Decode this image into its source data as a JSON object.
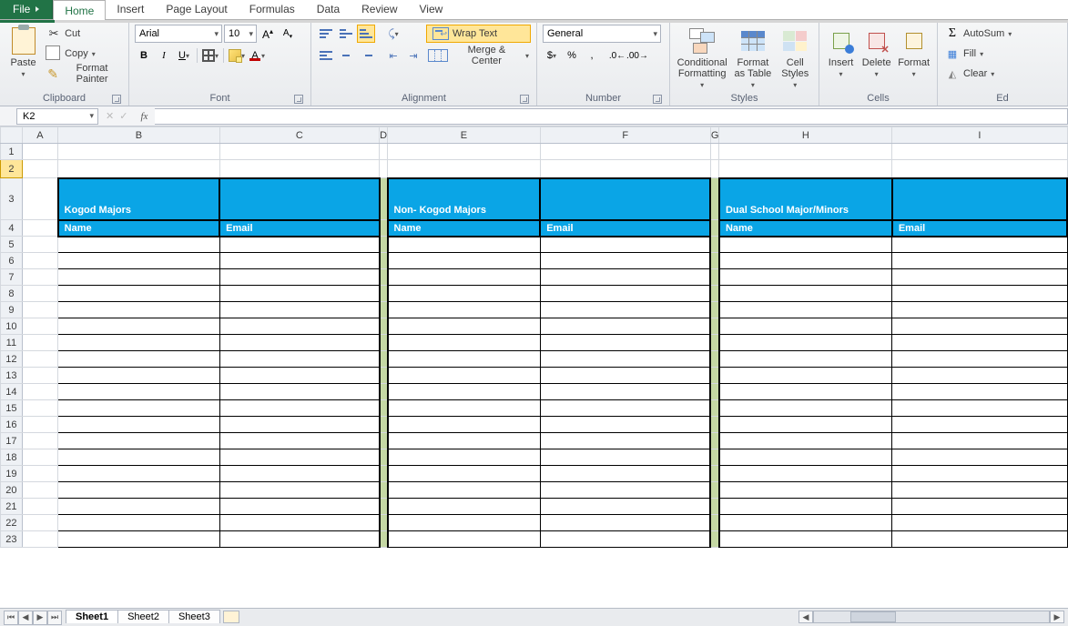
{
  "tabs": {
    "file": "File",
    "home": "Home",
    "insert": "Insert",
    "pageLayout": "Page Layout",
    "formulas": "Formulas",
    "data": "Data",
    "review": "Review",
    "view": "View"
  },
  "clipboard": {
    "paste": "Paste",
    "cut": "Cut",
    "copy": "Copy",
    "formatPainter": "Format Painter",
    "group": "Clipboard"
  },
  "font": {
    "name": "Arial",
    "size": "10",
    "group": "Font",
    "bold": "B",
    "italic": "I",
    "underline": "U"
  },
  "alignment": {
    "wrap": "Wrap Text",
    "merge": "Merge & Center",
    "group": "Alignment"
  },
  "number": {
    "format": "General",
    "currency": "$",
    "percent": "%",
    "comma": ",",
    "group": "Number"
  },
  "styles": {
    "cond": "Conditional Formatting",
    "fmtTable": "Format as Table",
    "cellStyles": "Cell Styles",
    "group": "Styles"
  },
  "cells": {
    "insert": "Insert",
    "delete": "Delete",
    "format": "Format",
    "group": "Cells"
  },
  "editing": {
    "autosum": "AutoSum",
    "fill": "Fill",
    "clear": "Clear",
    "group": "Ed"
  },
  "nameBox": "K2",
  "fx": "fx",
  "columns": [
    "A",
    "B",
    "C",
    "D",
    "E",
    "F",
    "G",
    "H",
    "I"
  ],
  "content": {
    "section1": "Kogod Majors",
    "section2": "Non- Kogod Majors",
    "section3": "Dual School Major/Minors",
    "name": "Name",
    "email": "Email"
  },
  "rowCount": 23,
  "sheetTabs": {
    "s1": "Sheet1",
    "s2": "Sheet2",
    "s3": "Sheet3"
  }
}
